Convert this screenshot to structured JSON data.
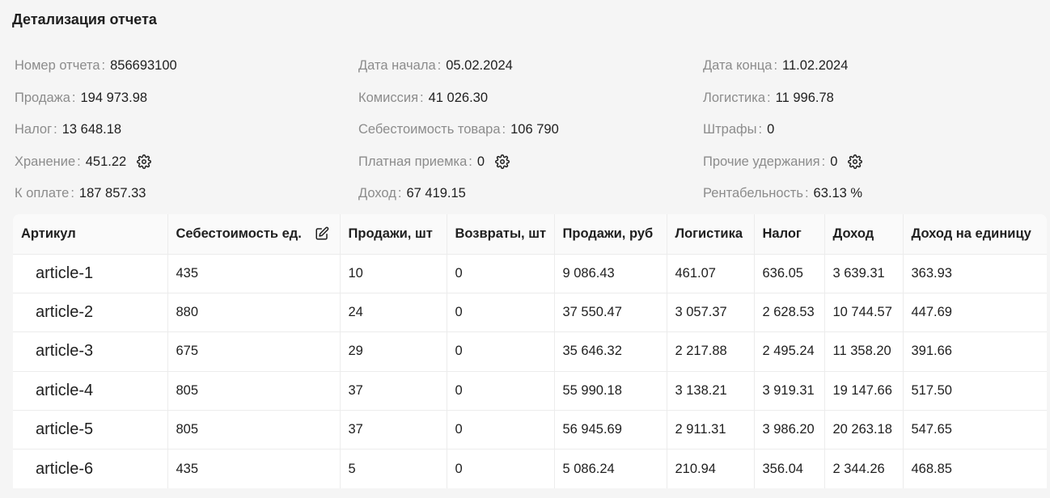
{
  "page_title": "Детализация отчета",
  "details": {
    "col1": [
      {
        "label": "Номер отчета",
        "value": "856693100"
      },
      {
        "label": "Продажа",
        "value": "194 973.98"
      },
      {
        "label": "Налог",
        "value": "13 648.18"
      },
      {
        "label": "Хранение",
        "value": "451.22",
        "icon": "gear-icon"
      },
      {
        "label": "К оплате",
        "value": "187 857.33"
      }
    ],
    "col2": [
      {
        "label": "Дата начала",
        "value": "05.02.2024"
      },
      {
        "label": "Комиссия",
        "value": "41 026.30"
      },
      {
        "label": "Себестоимость товара",
        "value": "106 790"
      },
      {
        "label": "Платная приемка",
        "value": "0",
        "icon": "gear-icon"
      },
      {
        "label": "Доход",
        "value": "67 419.15"
      }
    ],
    "col3": [
      {
        "label": "Дата конца",
        "value": "11.02.2024"
      },
      {
        "label": "Логистика",
        "value": "11 996.78"
      },
      {
        "label": "Штрафы",
        "value": "0"
      },
      {
        "label": "Прочие удержания",
        "value": "0",
        "icon": "gear-icon"
      },
      {
        "label": "Рентабельность",
        "value": "63.13 %"
      }
    ]
  },
  "table": {
    "headers": [
      "Артикул",
      "Себестоимость ед.",
      "Продажи, шт",
      "Возвраты, шт",
      "Продажи, руб",
      "Логистика",
      "Налог",
      "Доход",
      "Доход на единицу"
    ],
    "cost_header_icon": "edit-icon",
    "rows": [
      [
        "article-1",
        "435",
        "10",
        "0",
        "9 086.43",
        "461.07",
        "636.05",
        "3 639.31",
        "363.93"
      ],
      [
        "article-2",
        "880",
        "24",
        "0",
        "37 550.47",
        "3 057.37",
        "2 628.53",
        "10 744.57",
        "447.69"
      ],
      [
        "article-3",
        "675",
        "29",
        "0",
        "35 646.32",
        "2 217.88",
        "2 495.24",
        "11 358.20",
        "391.66"
      ],
      [
        "article-4",
        "805",
        "37",
        "0",
        "55 990.18",
        "3 138.21",
        "3 919.31",
        "19 147.66",
        "517.50"
      ],
      [
        "article-5",
        "805",
        "37",
        "0",
        "56 945.69",
        "2 911.31",
        "3 986.20",
        "20 263.18",
        "547.65"
      ],
      [
        "article-6",
        "435",
        "5",
        "0",
        "5 086.24",
        "210.94",
        "356.04",
        "2 344.26",
        "468.85"
      ]
    ]
  }
}
